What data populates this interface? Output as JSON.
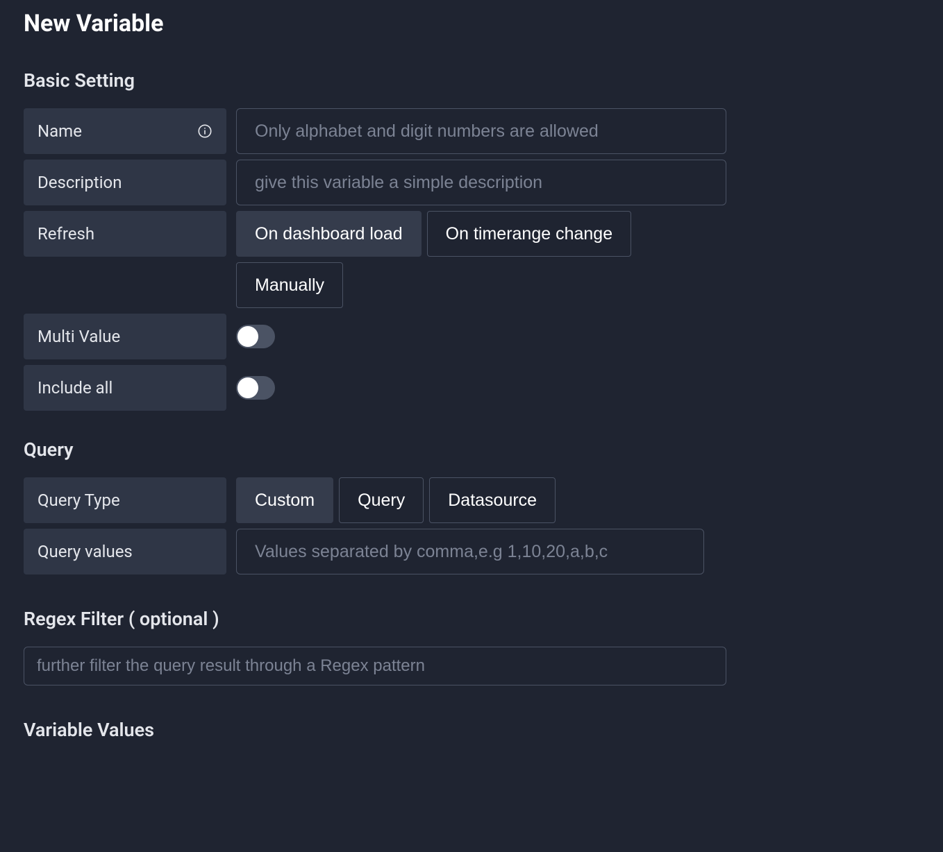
{
  "page": {
    "title": "New Variable"
  },
  "sections": {
    "basic": "Basic Setting",
    "query": "Query",
    "regex": "Regex Filter ( optional )",
    "values": "Variable Values"
  },
  "basic": {
    "name_label": "Name",
    "name_placeholder": "Only alphabet and digit numbers are allowed",
    "description_label": "Description",
    "description_placeholder": "give this variable a simple description",
    "refresh_label": "Refresh",
    "refresh_options": {
      "dashboard_load": "On dashboard load",
      "timerange_change": "On timerange change",
      "manually": "Manually"
    },
    "multi_value_label": "Multi Value",
    "include_all_label": "Include all"
  },
  "query": {
    "type_label": "Query Type",
    "type_options": {
      "custom": "Custom",
      "query": "Query",
      "datasource": "Datasource"
    },
    "values_label": "Query values",
    "values_placeholder": "Values separated by comma,e.g 1,10,20,a,b,c"
  },
  "regex": {
    "placeholder": "further filter the query result through a Regex pattern"
  }
}
